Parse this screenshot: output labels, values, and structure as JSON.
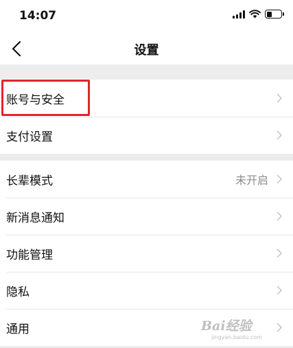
{
  "status_bar": {
    "time": "14:07",
    "icons": [
      "signal-icon",
      "wifi-icon",
      "battery-icon"
    ],
    "battery_level": 0.35
  },
  "nav": {
    "back_icon": "chevron-left-icon",
    "title": "设置"
  },
  "groups": [
    {
      "items": [
        {
          "label": "账号与安全"
        },
        {
          "label": "支付设置"
        }
      ]
    },
    {
      "items": [
        {
          "label": "长辈模式",
          "value": "未开启"
        },
        {
          "label": "新消息通知"
        },
        {
          "label": "功能管理"
        },
        {
          "label": "隐私"
        },
        {
          "label": "通用"
        }
      ]
    }
  ],
  "annotation": {
    "color": "#e0242e",
    "target": "账号与安全"
  },
  "watermark": {
    "logo_text": "Bai经验",
    "url": "jingyan.baidu.com"
  },
  "colors": {
    "background": "#ededed",
    "surface": "#ffffff",
    "text": "#111111",
    "muted": "#8c8c8c",
    "chevron": "#c4c4c4"
  }
}
